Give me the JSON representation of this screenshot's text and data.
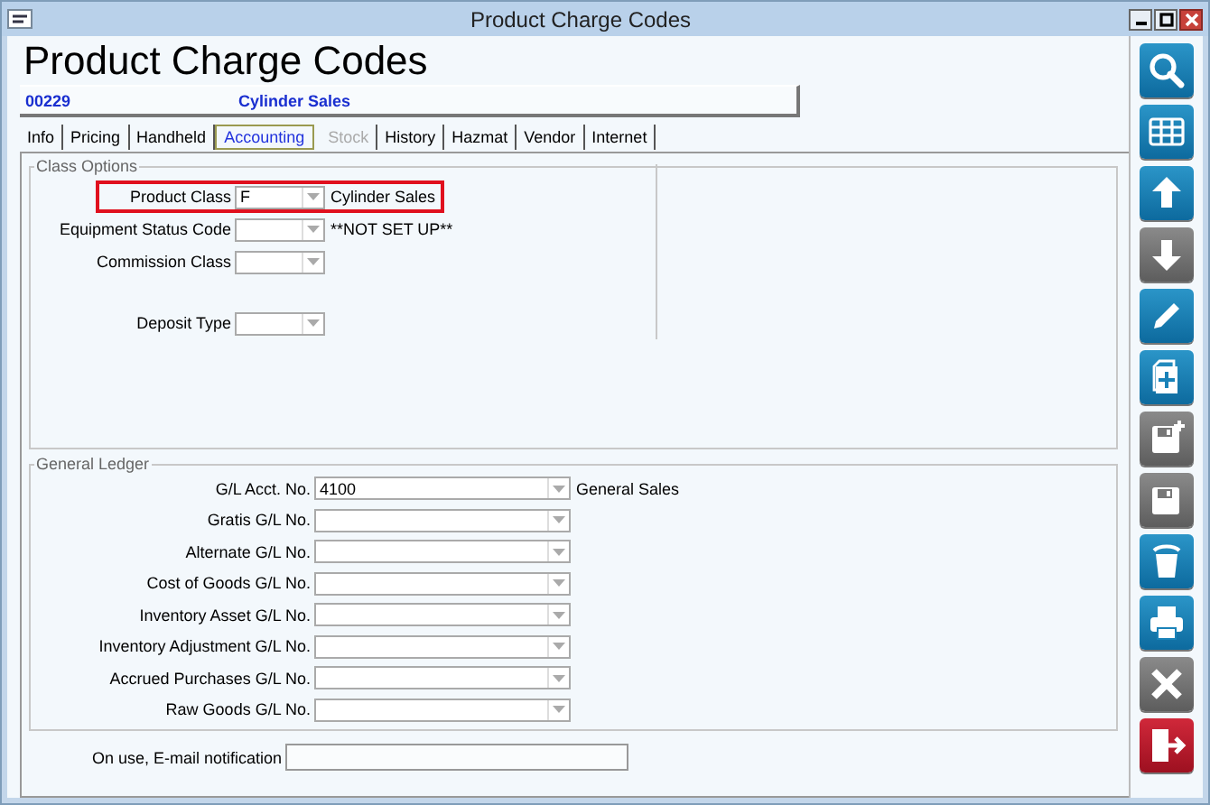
{
  "window": {
    "title": "Product Charge Codes"
  },
  "heading": "Product Charge Codes",
  "record": {
    "code": "00229",
    "name": "Cylinder Sales"
  },
  "tabs": [
    {
      "label": "Info",
      "selected": false,
      "disabled": false
    },
    {
      "label": "Pricing",
      "selected": false,
      "disabled": false
    },
    {
      "label": "Handheld",
      "selected": false,
      "disabled": false
    },
    {
      "label": "Accounting",
      "selected": true,
      "disabled": false
    },
    {
      "label": "Stock",
      "selected": false,
      "disabled": true
    },
    {
      "label": "History",
      "selected": false,
      "disabled": false
    },
    {
      "label": "Hazmat",
      "selected": false,
      "disabled": false
    },
    {
      "label": "Vendor",
      "selected": false,
      "disabled": false
    },
    {
      "label": "Internet",
      "selected": false,
      "disabled": false
    }
  ],
  "class_options": {
    "title": "Class Options",
    "fields": [
      {
        "label": "Product Class",
        "value": "F",
        "description": "Cylinder Sales",
        "highlighted": true
      },
      {
        "label": "Equipment Status Code",
        "description": "**NOT SET UP**",
        "highlighted": false
      },
      {
        "label": "Commission Class",
        "highlighted": false
      },
      {
        "label": "Deposit Type",
        "highlighted": false
      }
    ]
  },
  "general_ledger": {
    "title": "General Ledger",
    "fields": [
      {
        "label": "G/L Acct. No.",
        "value": "4100",
        "description": "General Sales"
      },
      {
        "label": "Gratis G/L No."
      },
      {
        "label": "Alternate G/L No."
      },
      {
        "label": "Cost of Goods G/L No."
      },
      {
        "label": "Inventory Asset G/L No."
      },
      {
        "label": "Inventory Adjustment G/L No."
      },
      {
        "label": "Accrued Purchases G/L No."
      },
      {
        "label": "Raw Goods G/L No."
      }
    ]
  },
  "email_notification": {
    "label": "On use, E-mail notification"
  },
  "toolbar": [
    {
      "kind": "search",
      "enabled": true
    },
    {
      "kind": "grid",
      "enabled": true
    },
    {
      "kind": "up",
      "enabled": true
    },
    {
      "kind": "down",
      "enabled": false
    },
    {
      "kind": "edit",
      "enabled": true
    },
    {
      "kind": "new",
      "enabled": true
    },
    {
      "kind": "save-new",
      "enabled": false
    },
    {
      "kind": "save",
      "enabled": false
    },
    {
      "kind": "delete",
      "enabled": true
    },
    {
      "kind": "print",
      "enabled": true
    },
    {
      "kind": "cancel",
      "enabled": false
    },
    {
      "kind": "exit",
      "enabled": true
    }
  ]
}
